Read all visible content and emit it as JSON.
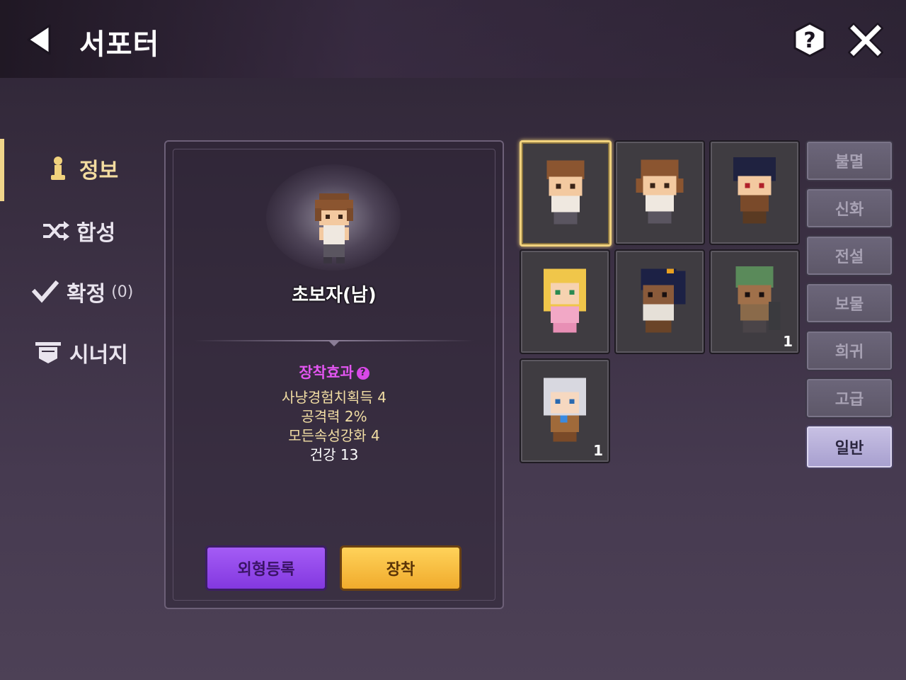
{
  "header": {
    "title": "서포터"
  },
  "sidebar": {
    "items": [
      {
        "label": "정보",
        "sub": "",
        "icon": "pawn-icon",
        "active": true
      },
      {
        "label": "합성",
        "sub": "",
        "icon": "shuffle-icon",
        "active": false
      },
      {
        "label": "확정",
        "sub": "(0)",
        "icon": "check-icon",
        "active": false
      },
      {
        "label": "시너지",
        "sub": "",
        "icon": "banner-icon",
        "active": false
      }
    ]
  },
  "detail": {
    "name": "초보자(남)",
    "effect_title": "장착효과",
    "effects": [
      "사냥경험치획득 4",
      "공격력 2%",
      "모든속성강화 4"
    ],
    "extra_stat": "건강 13",
    "buttons": {
      "appearance": "외형등록",
      "equip": "장착"
    }
  },
  "supporters": [
    {
      "name": "brown-hair-boy",
      "count": "",
      "selected": true
    },
    {
      "name": "brown-hair-girl",
      "count": "",
      "selected": false
    },
    {
      "name": "dark-hair-warrior",
      "count": "",
      "selected": false
    },
    {
      "name": "blonde-elf",
      "count": "",
      "selected": false
    },
    {
      "name": "ponytail-fighter",
      "count": "",
      "selected": false
    },
    {
      "name": "green-hair-rogue",
      "count": "1",
      "selected": false
    },
    {
      "name": "silver-hair-girl",
      "count": "1",
      "selected": false
    }
  ],
  "grade_tabs": [
    {
      "label": "불멸",
      "active": false
    },
    {
      "label": "신화",
      "active": false
    },
    {
      "label": "전설",
      "active": false
    },
    {
      "label": "보물",
      "active": false
    },
    {
      "label": "희귀",
      "active": false
    },
    {
      "label": "고급",
      "active": false
    },
    {
      "label": "일반",
      "active": true
    }
  ],
  "colors": {
    "accent_gold": "#f1d27d",
    "effect_title": "#e255f0",
    "effect_text": "#f2dea4",
    "equip_button": "#f0ab2c",
    "appearance_button": "#8338e0"
  }
}
